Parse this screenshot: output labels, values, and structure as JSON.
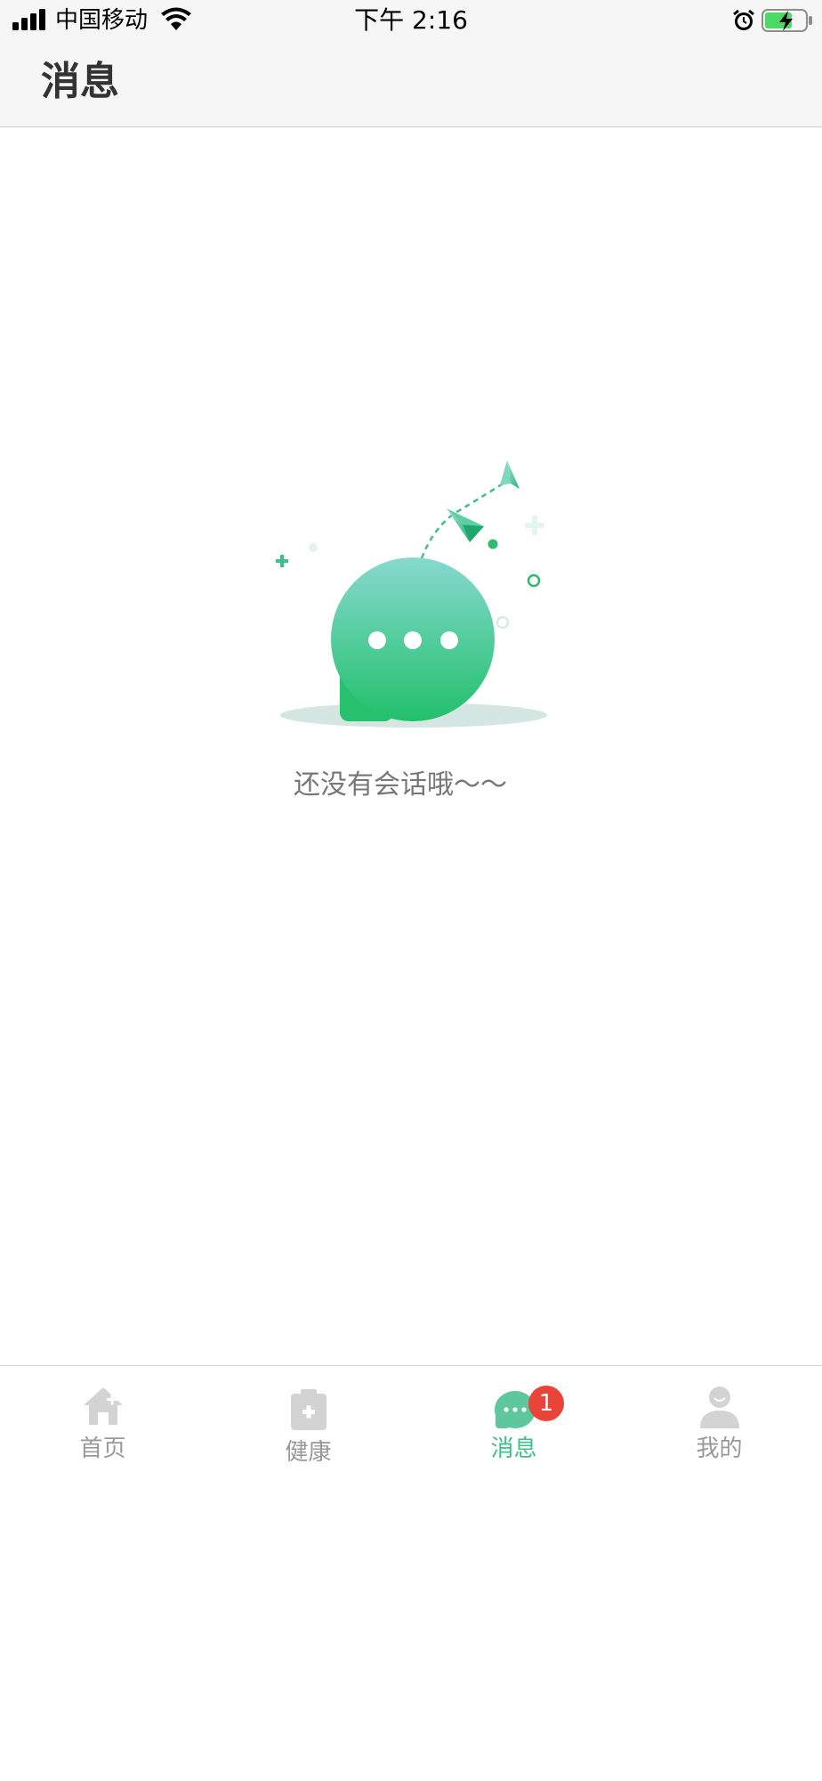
{
  "status_bar": {
    "carrier": "中国移动",
    "time": "下午 2:16",
    "icons": [
      "signal-icon",
      "wifi-icon",
      "alarm-icon",
      "battery-charging-icon"
    ]
  },
  "header": {
    "title": "消息"
  },
  "empty_state": {
    "message": "还没有会话哦～～",
    "illustration": "chat-bubble-paper-plane"
  },
  "tab_bar": {
    "tabs": [
      {
        "label": "首页",
        "icon": "home-icon",
        "active": false
      },
      {
        "label": "健康",
        "icon": "medical-kit-icon",
        "active": false
      },
      {
        "label": "消息",
        "icon": "chat-icon",
        "active": true,
        "badge": "1"
      },
      {
        "label": "我的",
        "icon": "user-icon",
        "active": false
      }
    ]
  },
  "colors": {
    "accent": "#3ec08b",
    "inactive": "#999999",
    "badge": "#e8443a",
    "header_bg": "#f6f6f6"
  }
}
